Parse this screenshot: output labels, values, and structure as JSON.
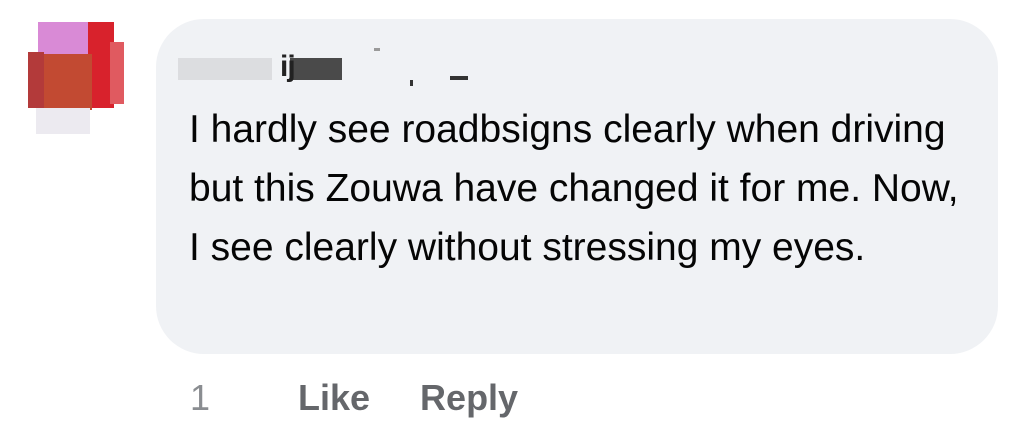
{
  "comment": {
    "author": {
      "name_fragment": "ij"
    },
    "text": "I hardly see roadbsigns clearly when driving but this Zouwa have changed it for me. Now, I see clearly without stressing my eyes.",
    "timestamp": "1",
    "actions": {
      "like_label": "Like",
      "reply_label": "Reply"
    }
  },
  "colors": {
    "bubble": "#f0f2f5",
    "text": "#050505",
    "action": "#65676b",
    "timestamp": "#8a8d91"
  }
}
